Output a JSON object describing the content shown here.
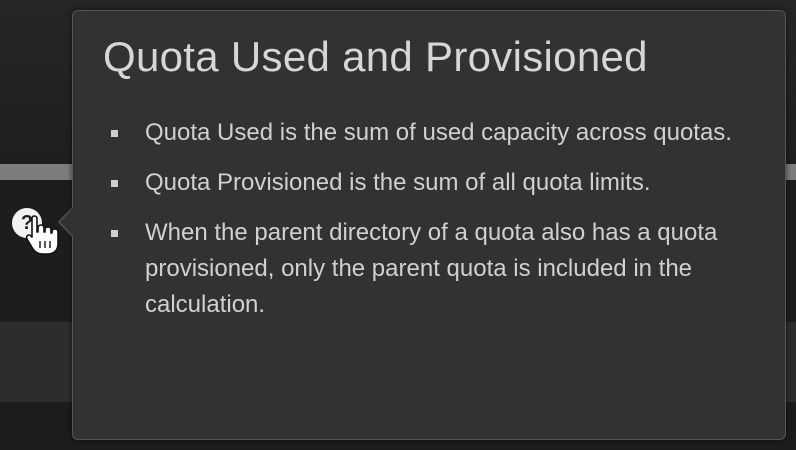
{
  "help": {
    "icon_glyph": "?"
  },
  "popover": {
    "title": "Quota Used and Provisioned",
    "bullets": [
      "Quota Used is the sum of used capacity across quotas.",
      "Quota Provisioned is the sum of all quota limits.",
      "When the parent directory of a quota also has a quota provisioned, only the parent quota is included in the calculation."
    ]
  },
  "colors": {
    "popover_background": "#323232",
    "popover_border": "#555555",
    "title_text": "#d6d6d6",
    "body_text": "#d0d0d0",
    "page_background": "#1e1e1e"
  },
  "icons": {
    "help": "help-circle-icon",
    "cursor": "hand-pointer-cursor-icon"
  }
}
